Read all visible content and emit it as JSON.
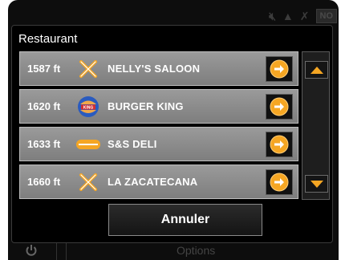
{
  "dialog": {
    "title": "Restaurant",
    "cancel_label": "Annuler"
  },
  "restaurants": [
    {
      "distance": "1587 ft",
      "name": "NELLY'S SALOON",
      "icon": "cutlery-icon"
    },
    {
      "distance": "1620 ft",
      "name": "BURGER KING",
      "icon": "burger-king-logo"
    },
    {
      "distance": "1633 ft",
      "name": "S&S DELI",
      "icon": "deli-sandwich-icon"
    },
    {
      "distance": "1660 ft",
      "name": "LA ZACATECANA",
      "icon": "cutlery-icon"
    }
  ],
  "logo_text": "BURGER KING",
  "status": {
    "no_badge": "NO"
  },
  "bottom_bar": {
    "options_label": "Options"
  },
  "colors": {
    "accent": "#f5a623",
    "row": "#8a8a8a",
    "background": "#000000"
  }
}
